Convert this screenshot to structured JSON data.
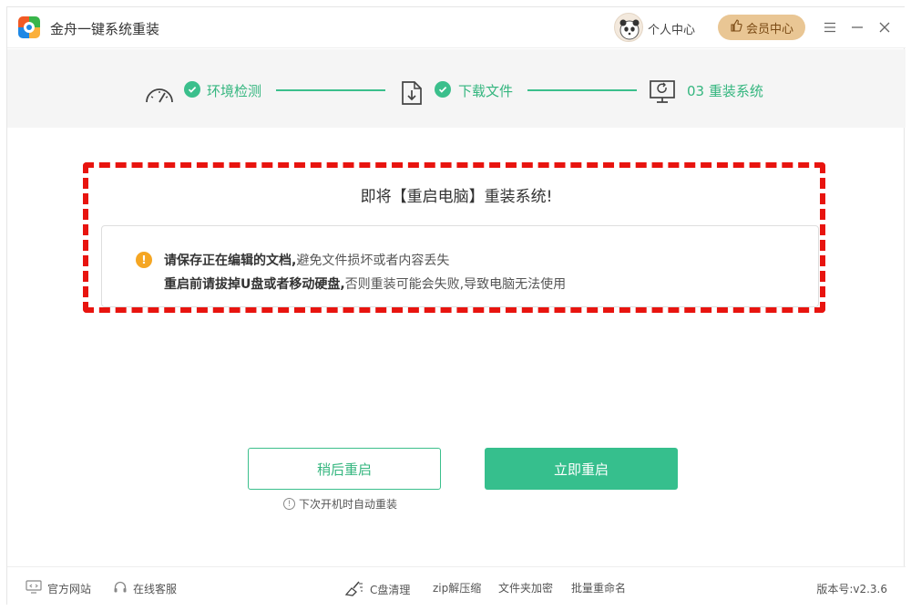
{
  "app": {
    "title": "金舟一键系统重装"
  },
  "header": {
    "user_center": "个人中心",
    "member_center": "会员中心"
  },
  "steps": [
    {
      "label": "环境检测"
    },
    {
      "label": "下载文件"
    },
    {
      "label": "03 重装系统"
    }
  ],
  "notice": {
    "title": "即将【重启电脑】重装系统!",
    "line1_bold": "请保存正在编辑的文档,",
    "line1_rest": "避免文件损坏或者内容丢失",
    "line2_bold": "重启前请拔掉U盘或者移动硬盘,",
    "line2_rest": "否则重装可能会失败,导致电脑无法使用"
  },
  "actions": {
    "later": "稍后重启",
    "now": "立即重启",
    "hint": "下次开机时自动重装"
  },
  "footer": {
    "website": "官方网站",
    "service": "在线客服",
    "clean": "C盘清理",
    "zip": "zip解压缩",
    "encrypt": "文件夹加密",
    "rename": "批量重命名",
    "version": "版本号:v2.3.6"
  },
  "colors": {
    "accent": "#36bf8d",
    "highlight_border": "#e8140f",
    "member": "#e9c694"
  }
}
